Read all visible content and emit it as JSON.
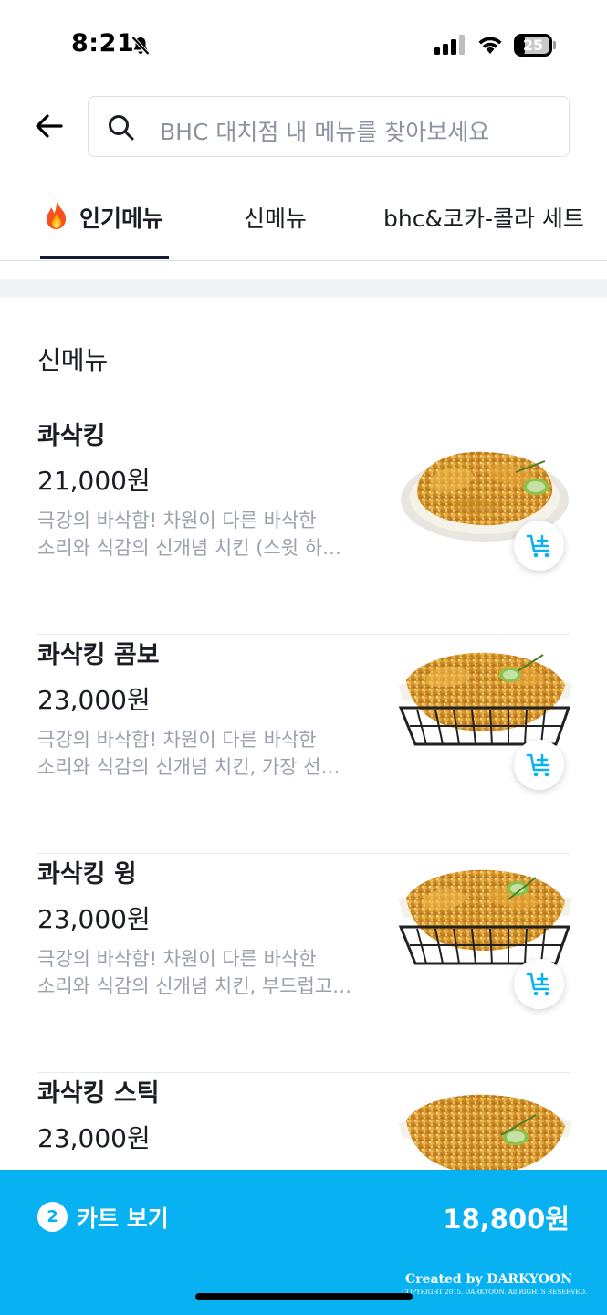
{
  "status_bar": {
    "time": "8:21",
    "battery_level": "25",
    "battery_fraction": 0.25
  },
  "search": {
    "placeholder": "BHC 대치점 내 메뉴를 찾아보세요"
  },
  "tabs": [
    {
      "label": "인기메뉴",
      "active": true,
      "icon": "fire-icon"
    },
    {
      "label": "신메뉴",
      "active": false
    },
    {
      "label": "bhc&코카-콜라 세트",
      "active": false
    }
  ],
  "section": {
    "title": "신메뉴"
  },
  "menu_items": [
    {
      "name": "콰삭킹",
      "price": "21,000원",
      "desc_line1": "극강의 바삭함! 차원이 다른 바삭한",
      "desc_line2": "소리와 식감의 신개념 치킨 (스윗 하…",
      "image": "chicken-plate"
    },
    {
      "name": "콰삭킹 콤보",
      "price": "23,000원",
      "desc_line1": "극강의 바삭함! 차원이 다른 바삭한",
      "desc_line2": "소리와 식감의 신개념 치킨, 가장 선…",
      "image": "chicken-basket"
    },
    {
      "name": "콰삭킹 윙",
      "price": "23,000원",
      "desc_line1": "극강의 바삭함! 차원이 다른 바삭한",
      "desc_line2": "소리와 식감의 신개념 치킨, 부드럽고…",
      "image": "chicken-basket"
    },
    {
      "name": "콰삭킹 스틱",
      "price": "23,000원",
      "desc_line1": "",
      "desc_line2": "",
      "image": "chicken-basket"
    }
  ],
  "cart": {
    "count": "2",
    "label": "카트 보기",
    "total": "18,800원"
  },
  "watermark": {
    "title": "Created by DARKYOON",
    "subtitle": "COPYRIGHT 2015. DARKYOON. All RIGHTS RESERVED."
  },
  "colors": {
    "accent": "#08b1f2",
    "tab_underline": "#141b34",
    "text_primary": "#1a1d24",
    "text_secondary": "#9aa1ad"
  }
}
